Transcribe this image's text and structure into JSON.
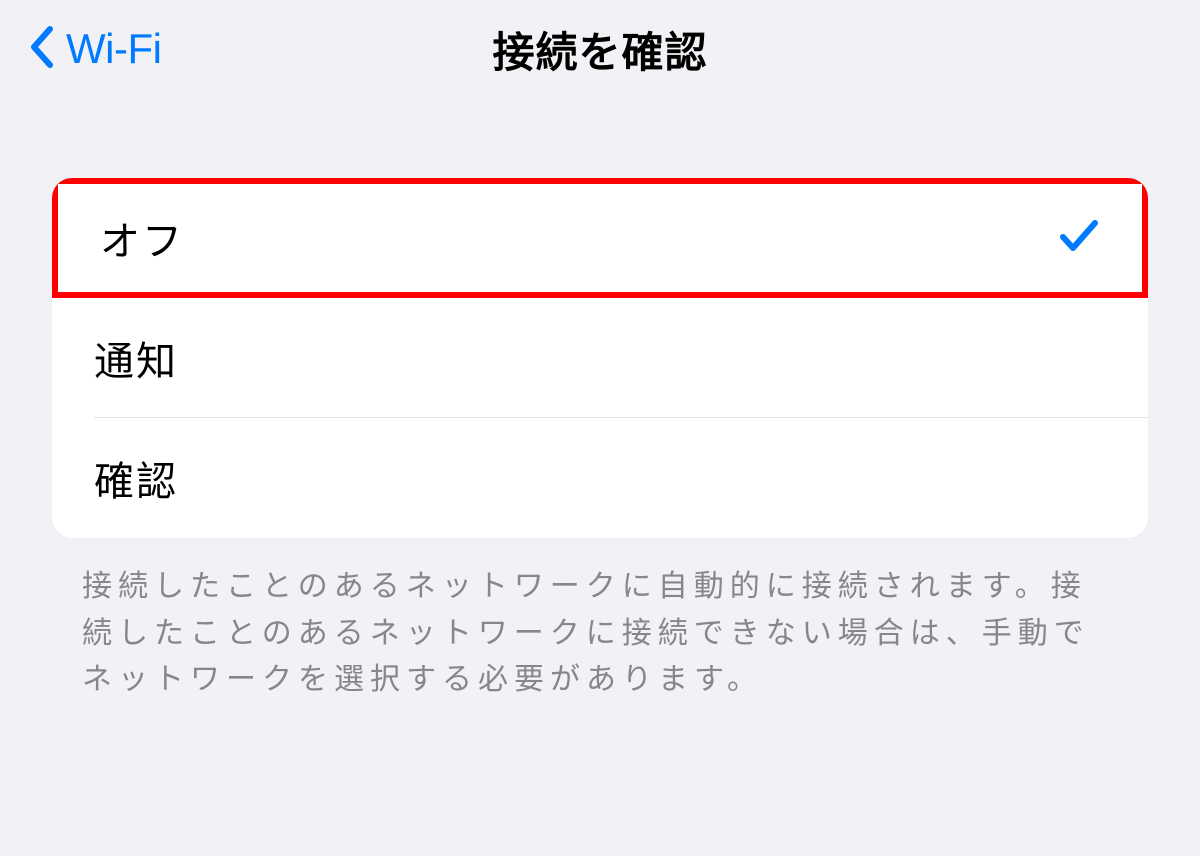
{
  "navbar": {
    "back_label": "Wi-Fi",
    "title": "接続を確認"
  },
  "options": {
    "items": [
      {
        "label": "オフ",
        "selected": true,
        "highlighted": true
      },
      {
        "label": "通知",
        "selected": false,
        "highlighted": false
      },
      {
        "label": "確認",
        "selected": false,
        "highlighted": false
      }
    ]
  },
  "footer_text": "接続したことのあるネットワークに自動的に接続されます。接続したことのあるネットワークに接続できない場合は、手動でネットワークを選択する必要があります。",
  "colors": {
    "accent": "#007aff",
    "highlight_border": "#ff0000"
  }
}
